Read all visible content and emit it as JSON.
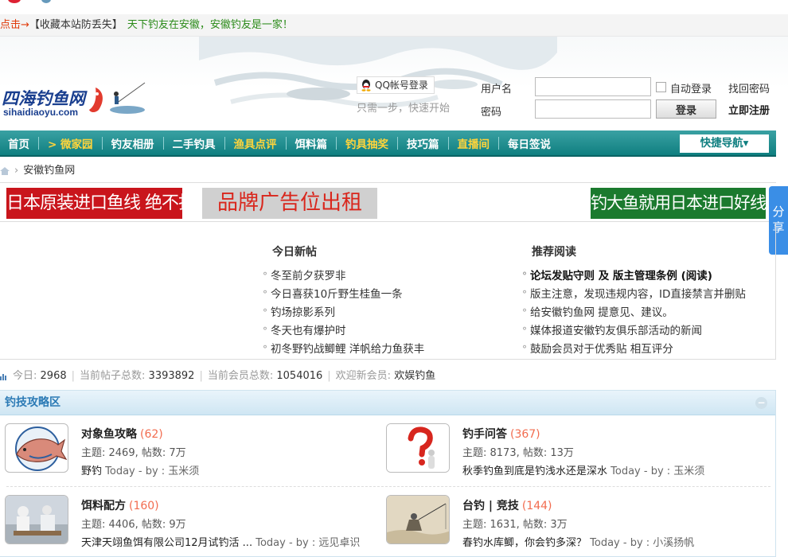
{
  "announce": {
    "click_prefix": "点击→",
    "bookmark": "【收藏本站防丢失】",
    "slogan": "天下钓友在安徽，安徽钓友是一家！"
  },
  "header": {
    "logo_cn": "四海钓鱼网",
    "logo_en": "sihaidiaoyu.com",
    "qq_login": "QQ帐号登录",
    "qq_hint": "只需一步，快速开始",
    "username_label": "用户名",
    "password_label": "密码",
    "auto_login": "自动登录",
    "forgot": "找回密码",
    "login": "登录",
    "register": "立即注册"
  },
  "nav": {
    "items": [
      {
        "label": "首页",
        "highlight": false
      },
      {
        "label": "> 微家园",
        "highlight": true
      },
      {
        "label": "钓友相册",
        "highlight": false
      },
      {
        "label": "二手钓具",
        "highlight": false
      },
      {
        "label": "渔具点评",
        "highlight": true
      },
      {
        "label": "饵料篇",
        "highlight": false
      },
      {
        "label": "钓具抽奖",
        "highlight": true
      },
      {
        "label": "技巧篇",
        "highlight": false
      },
      {
        "label": "直播间",
        "highlight": true
      },
      {
        "label": "每日签说",
        "highlight": false
      }
    ],
    "quick_nav": "快捷导航▾"
  },
  "breadcrumb": {
    "current": "安徽钓鱼网"
  },
  "banners": {
    "b1": "日本原装进口鱼线 绝不打卷",
    "b2": "品牌广告位出租",
    "b3": "钓大鱼就用日本进口好线"
  },
  "share": {
    "label": "分享"
  },
  "posts": {
    "today_title": "今日新帖",
    "today": [
      "冬至前夕获罗非",
      "今日喜获10斤野生桂鱼一条",
      "钓场掠影系列",
      "冬天也有爆护时",
      "初冬野钓战鲫鲤 洋帆给力鱼获丰"
    ],
    "recommend_title": "推荐阅读",
    "recommend": [
      {
        "text": "论坛发贴守则 及 版主管理条例 (阅读)",
        "bold": true
      },
      {
        "text": "版主注意，发现违规内容，ID直接禁言并删贴",
        "bold": false
      },
      {
        "text": "给安徽钓鱼网 提意见、建议。",
        "bold": false
      },
      {
        "text": "媒体报道安徽钓友俱乐部活动的新闻",
        "bold": false
      },
      {
        "text": "鼓励会员对于优秀贴 相互评分",
        "bold": false
      }
    ]
  },
  "stats": {
    "today_label": "今日:",
    "today_value": "2968",
    "posts_label": "当前帖子总数:",
    "posts_value": "3393892",
    "members_label": "当前会员总数:",
    "members_value": "1054016",
    "welcome_label": "欢迎新会员:",
    "welcome_value": "欢娱钓鱼"
  },
  "section": {
    "title": "钓技攻略区",
    "collapse": "−",
    "forums": [
      {
        "name": "对象鱼攻略",
        "count": "(62)",
        "stats": "主题: 2469, 帖数: 7万",
        "last": "野钓",
        "meta": "Today - by : 玉米须"
      },
      {
        "name": "钓手问答",
        "count": "(367)",
        "stats": "主题: 8173, 帖数: 13万",
        "last": "秋季钓鱼到底是钓浅水还是深水",
        "meta": "Today - by : 玉米须"
      },
      {
        "name": "饵料配方",
        "count": "(160)",
        "stats": "主题: 4406, 帖数: 9万",
        "last": "天津天翊鱼饵有限公司12月试钓活 ...",
        "meta": "Today - by : 远见卓识"
      },
      {
        "name": "台钓 | 竞技",
        "count": "(144)",
        "stats": "主题: 1631, 帖数: 3万",
        "last": "春钓水库鲫，你会钓多深？",
        "meta": "Today - by : 小溪扬帆"
      }
    ]
  },
  "colors": {
    "nav": "#0f7f80",
    "nav_highlight": "#ffd43b",
    "accent_count": "#f26c4f",
    "section_title": "#2b7ab5",
    "banner_red": "#c9151c",
    "banner_green": "#1b7a2e"
  }
}
